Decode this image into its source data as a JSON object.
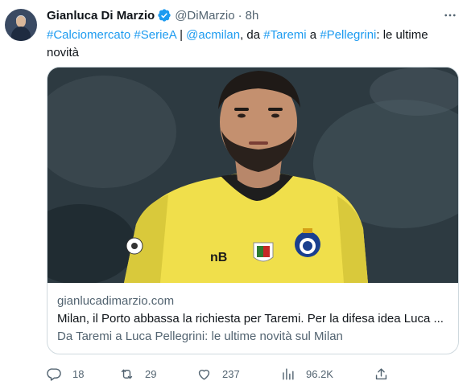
{
  "author": {
    "name": "Gianluca Di Marzio",
    "handle": "@DiMarzio",
    "separator": "·",
    "time": "8h",
    "verified_color": "#1d9bf0"
  },
  "tweet": {
    "segments": [
      {
        "text": "#Calciomercato",
        "link": true
      },
      {
        "text": " ",
        "link": false
      },
      {
        "text": "#SerieA",
        "link": true
      },
      {
        "text": " | ",
        "link": false
      },
      {
        "text": "@acmilan",
        "link": true
      },
      {
        "text": ", da ",
        "link": false
      },
      {
        "text": "#Taremi",
        "link": true
      },
      {
        "text": " a ",
        "link": false
      },
      {
        "text": "#Pellegrini",
        "link": true
      },
      {
        "text": ": le ultime novità",
        "link": false
      }
    ]
  },
  "card": {
    "domain": "gianlucadimarzio.com",
    "title": "Milan, il Porto abbassa la richiesta per Taremi. Per la difesa idea Luca ...",
    "description": "Da Taremi a Luca Pellegrini: le ultime novità sul Milan"
  },
  "actions": {
    "reply_count": "18",
    "retweet_count": "29",
    "like_count": "237",
    "views_count": "96.2K"
  },
  "icons": {
    "more": "more-dots-icon",
    "reply": "reply-icon",
    "retweet": "retweet-icon",
    "like": "heart-icon",
    "views": "views-chart-icon",
    "share": "share-icon"
  },
  "colors": {
    "link": "#1d9bf0",
    "secondary_text": "#536471",
    "jersey": "#f2e14a"
  }
}
